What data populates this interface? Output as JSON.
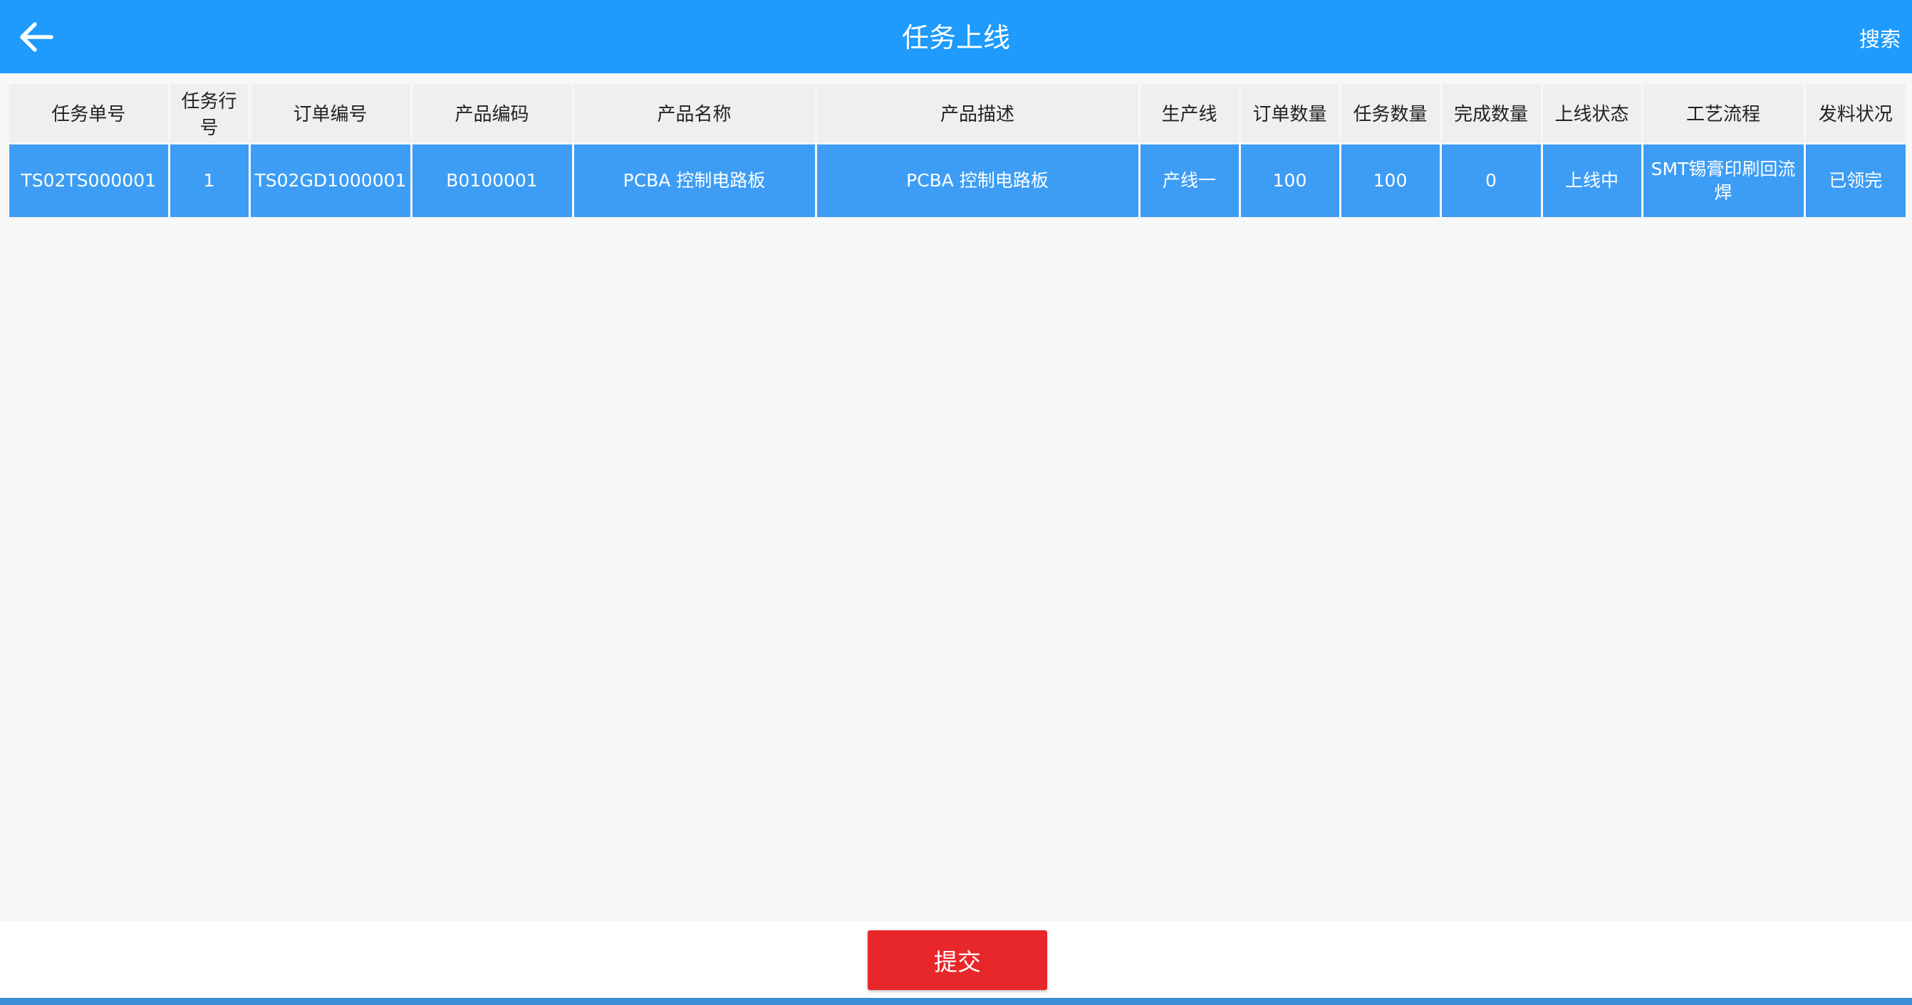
{
  "app_bar": {
    "title": "任务上线",
    "back_icon": "arrow-left-icon",
    "search_label": "搜索",
    "color": "#1e9bfd"
  },
  "table": {
    "columns": [
      "任务单号",
      "任务行号",
      "订单编号",
      "产品编码",
      "产品名称",
      "产品描述",
      "生产线",
      "订单数量",
      "任务数量",
      "完成数量",
      "上线状态",
      "工艺流程",
      "发料状况"
    ],
    "rows": [
      {
        "selected": true,
        "cells": [
          "TS02TS000001",
          "1",
          "TS02GD1000001",
          "B0100001",
          "PCBA 控制电路板",
          "PCBA 控制电路板",
          "产线一",
          "100",
          "100",
          "0",
          "上线中",
          "SMT锡膏印刷回流焊",
          "已领完"
        ]
      }
    ],
    "selected_row_color": "#3d9df5"
  },
  "footer": {
    "submit_label": "提交",
    "submit_color": "#e8272a"
  }
}
